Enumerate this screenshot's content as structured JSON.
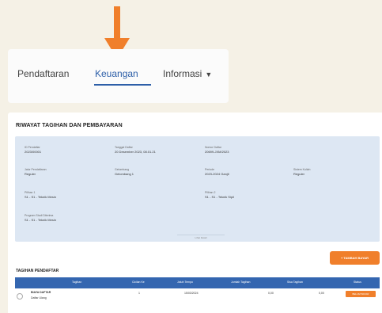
{
  "nav": {
    "items": [
      {
        "label": "Pendaftaran"
      },
      {
        "label": "Keuangan"
      },
      {
        "label": "Informasi"
      }
    ],
    "active_index": 1,
    "chevron": "chevron-down-icon"
  },
  "section": {
    "title": "RIWAYAT TAGIHAN DAN PEMBAYARAN"
  },
  "info": {
    "f1": {
      "label": "ID Pendaftar",
      "value": "2023/00001"
    },
    "f2": {
      "label": "Tanggal Daftar",
      "value": "20 Desember 2023, 08.01.21"
    },
    "f3": {
      "label": "Nomor Daftar",
      "value": "20699-JXM/2023"
    },
    "f4": {
      "label": "Jalur Pendaftaran",
      "value": "Reguler"
    },
    "f5": {
      "label": "Gelombang",
      "value": "Gelombang 1"
    },
    "f6": {
      "label": "Periode",
      "value": "2023-2024 Ganjil"
    },
    "f7": {
      "label": "Sistem Kuliah",
      "value": "Reguler"
    },
    "f8": {
      "label": "Pilihan 1",
      "value": "S1 - S1 - Teknik Mesin"
    },
    "f9": {
      "label": "Pilihan 2",
      "value": "S1 - S1 - Teknik Sipil"
    },
    "f10": {
      "label": "Program Studi Diterima",
      "value": "S1 - S1 - Teknik Mesin"
    },
    "footer": "Lihat Detail"
  },
  "action_button": {
    "label": "+ TAMBAH BAYAR"
  },
  "tagihan": {
    "title": "TAGIHAN PENDAFTAR",
    "columns": [
      "Tagihan",
      "Cicilan Ke",
      "Jatuh Tempo",
      "Jumlah Tagihan",
      "Sisa Tagihan",
      "Status"
    ],
    "rows": [
      {
        "name": "BIAYA DAFTAR",
        "sub": "Daftar Ulang",
        "cicilan": "1",
        "jatuh_tempo": "15/03/2024",
        "jumlah": "0,00",
        "sisa": "0,00",
        "status": "BELUM BAYAR"
      }
    ]
  },
  "colors": {
    "accent": "#2d5fa8",
    "arrow": "#f07f2b",
    "table_header": "#3466b0",
    "card": "#dde7f3"
  }
}
